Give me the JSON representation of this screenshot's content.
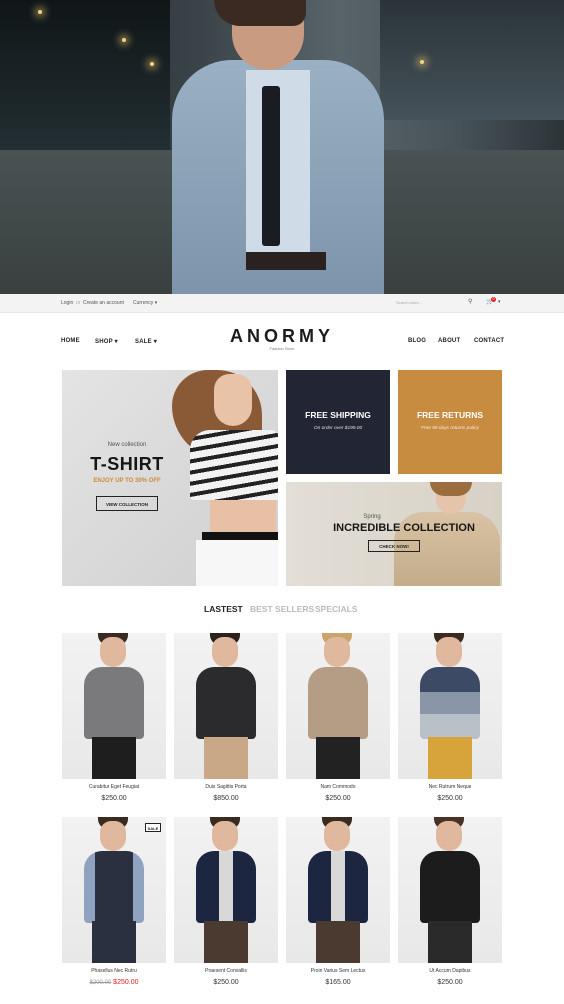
{
  "topbar": {
    "login": "Login",
    "separator": "or",
    "create_account": "Create an account",
    "currency": "Currency",
    "search_placeholder": "Search store...",
    "cart_count": "0"
  },
  "brand": {
    "name": "ANORMY",
    "tagline": "Fashion Store"
  },
  "nav": {
    "left": [
      "HOME",
      "SHOP",
      "SALE"
    ],
    "right": [
      "BLOG",
      "ABOUT",
      "CONTACT"
    ]
  },
  "banner_tshirt": {
    "kicker": "New collection",
    "title": "T-SHIRT",
    "subtitle": "ENJOY UP TO 30% OFF",
    "button": "VIEW COLLECTION"
  },
  "banner_shipping": {
    "title": "FREE SHIPPING",
    "subtitle": "On order over $199.00"
  },
  "banner_returns": {
    "title": "FREE RETURNS",
    "subtitle": "Free 90 days returns policy"
  },
  "banner_spring": {
    "kicker": "Spring",
    "title": "INCREDIBLE COLLECTION",
    "button": "CHECK NOW!"
  },
  "tabs": [
    "LASTEST",
    "BEST SELLERS",
    "SPECIALS"
  ],
  "products": [
    {
      "name": "Curabitur Eget Feugiat",
      "price": "$250.00"
    },
    {
      "name": "Duis Sagittis Porta",
      "price": "$850.00"
    },
    {
      "name": "Nam Commodo",
      "price": "$250.00"
    },
    {
      "name": "Nec Rutrum Neque",
      "price": "$250.00"
    },
    {
      "name": "Phasellus Nec Rutru",
      "old_price": "$200.00",
      "price": "$250.00",
      "badge": "SALE"
    },
    {
      "name": "Praesent Convallis",
      "price": "$250.00"
    },
    {
      "name": "Proin Varius Sem Lectus",
      "price": "$165.00"
    },
    {
      "name": "Ut Accum Dapibus",
      "price": "$250.00"
    }
  ],
  "colors": {
    "dark_box": "#222533",
    "accent": "#c88c40",
    "sale_price": "#dd2222"
  }
}
